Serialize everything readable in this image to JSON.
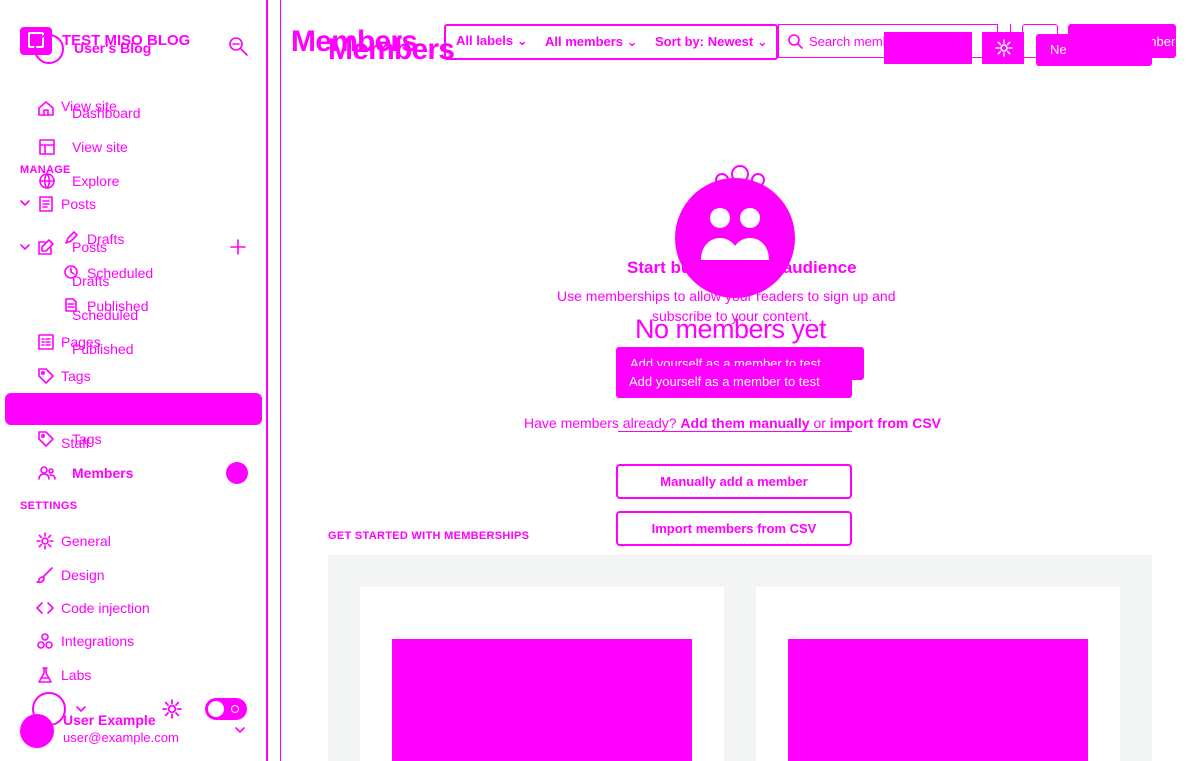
{
  "sidebar": {
    "site_title": "TEST MISO BLOG",
    "site_subtitle": "User's Blog",
    "nav": {
      "view_site_a": "View site",
      "dashboard": "Dashboard",
      "view_site_b": "View site",
      "explore": "Explore"
    },
    "manage_header": "MANAGE",
    "posts_a": "Posts",
    "posts_b": "Posts",
    "drafts_a": "Drafts",
    "drafts_b": "Drafts",
    "scheduled_a": "Scheduled",
    "scheduled_b": "Scheduled",
    "published_a": "Published",
    "published_b": "Published",
    "pages": "Pages",
    "tags_a": "Tags",
    "tags_b": "Tags",
    "staff": "Staff",
    "members": "Members",
    "settings_header": "SETTINGS",
    "settings": [
      {
        "label": "General",
        "icon": "gear-icon"
      },
      {
        "label": "Design",
        "icon": "brush-icon"
      },
      {
        "label": "Code injection",
        "icon": "code-icon"
      },
      {
        "label": "Integrations",
        "icon": "integrations-icon"
      },
      {
        "label": "Labs",
        "icon": "flask-icon"
      }
    ],
    "user": {
      "name": "User Example",
      "email": "user@example.com"
    }
  },
  "header": {
    "title_a": "Members",
    "title_b": "Members",
    "filters": {
      "labels": "All labels",
      "members": "All members",
      "sort": "Sort by: Newest"
    },
    "search_placeholder": "Search membe",
    "new_button_a": "New member",
    "new_button_b": "Ne"
  },
  "empty_state": {
    "heading": "Start building your audience",
    "desc_line1": "Use memberships to allow your readers to sign up and",
    "desc_line2": "subscribe to your content.",
    "big_heading": "No members yet",
    "add_self_a": "Add yourself as a member to test",
    "add_self_b": "Add yourself as a member to test",
    "help_prefix": "Have members already?",
    "help_link_a": "Add them manually",
    "help_mid": "or",
    "help_link_b": "import from CSV",
    "manual_add_button": "Manually add a member",
    "import_button": "Import members from CSV"
  },
  "get_started": {
    "header": "GET STARTED WITH MEMBERSHIPS"
  },
  "colors": {
    "accent": "#ff00ff",
    "panel": "#f3f4f4",
    "background": "#ffffff"
  }
}
